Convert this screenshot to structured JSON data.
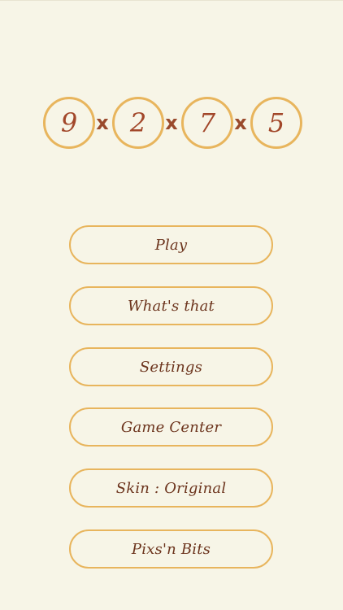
{
  "logo": {
    "digits": [
      "9",
      "2",
      "7",
      "5"
    ],
    "separator": "x"
  },
  "menu": {
    "play": "Play",
    "whats_that": "What's that",
    "settings": "Settings",
    "game_center": "Game Center",
    "skin": "Skin : Original",
    "pixs_bits": "Pixs'n Bits"
  },
  "colors": {
    "background": "#f7f5e7",
    "accent": "#e8b55d",
    "digit_text": "#a2472a",
    "button_text": "#6c341d"
  }
}
